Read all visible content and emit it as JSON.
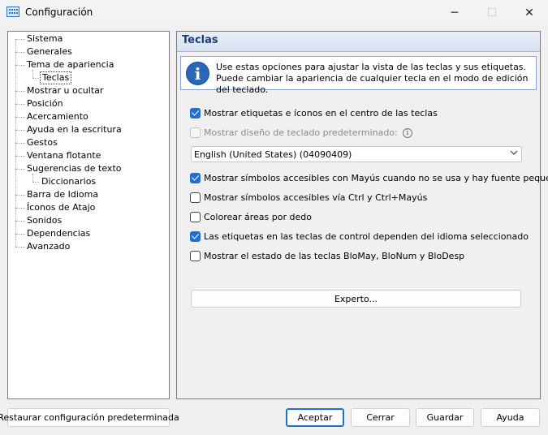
{
  "window": {
    "title": "Configuración"
  },
  "tree": {
    "items": [
      {
        "label": "Sistema"
      },
      {
        "label": "Generales"
      },
      {
        "label": "Tema de apariencia"
      },
      {
        "label": "Teclas"
      },
      {
        "label": "Mostrar u ocultar"
      },
      {
        "label": "Posición"
      },
      {
        "label": "Acercamiento"
      },
      {
        "label": "Ayuda en la escritura"
      },
      {
        "label": "Gestos"
      },
      {
        "label": "Ventana flotante"
      },
      {
        "label": "Sugerencias de texto"
      },
      {
        "label": "Diccionarios"
      },
      {
        "label": "Barra de Idioma"
      },
      {
        "label": "Íconos de Atajo"
      },
      {
        "label": "Sonidos"
      },
      {
        "label": "Dependencias"
      },
      {
        "label": "Avanzado"
      }
    ],
    "selected": "Teclas"
  },
  "panel": {
    "title": "Teclas",
    "info": "Use estas opciones para ajustar la vista de las teclas y sus etiquetas. Puede cambiar la apariencia de cualquier tecla en el modo de edición del teclado.",
    "options": [
      {
        "label": "Mostrar etiquetas e íconos en el centro de las teclas",
        "checked": true
      },
      {
        "label": "Mostrar diseño de teclado predeterminado:",
        "checked": false,
        "disabled": true
      },
      {
        "label": "Mostrar símbolos accesibles con Mayús cuando no se usa y hay fuente pequeña",
        "checked": true
      },
      {
        "label": "Mostrar símbolos accesibles vía Ctrl y Ctrl+Mayús",
        "checked": false
      },
      {
        "label": "Colorear áreas por dedo",
        "checked": false
      },
      {
        "label": "Las etiquetas en las teclas de control dependen del idioma seleccionado",
        "checked": true
      },
      {
        "label": "Mostrar el estado de las teclas BloMay, BloNum y BloDesp",
        "checked": false
      }
    ],
    "layout_select": {
      "value": "English (United States) (04090409)"
    },
    "expert_label": "Experto..."
  },
  "buttons": {
    "restore": "Restaurar configuración predeterminada",
    "accept": "Aceptar",
    "close": "Cerrar",
    "save": "Guardar",
    "help": "Ayuda"
  },
  "colors": {
    "accent": "#1e6fd0",
    "header_text": "#1a3d7c",
    "info_icon": "#2b67b8"
  }
}
